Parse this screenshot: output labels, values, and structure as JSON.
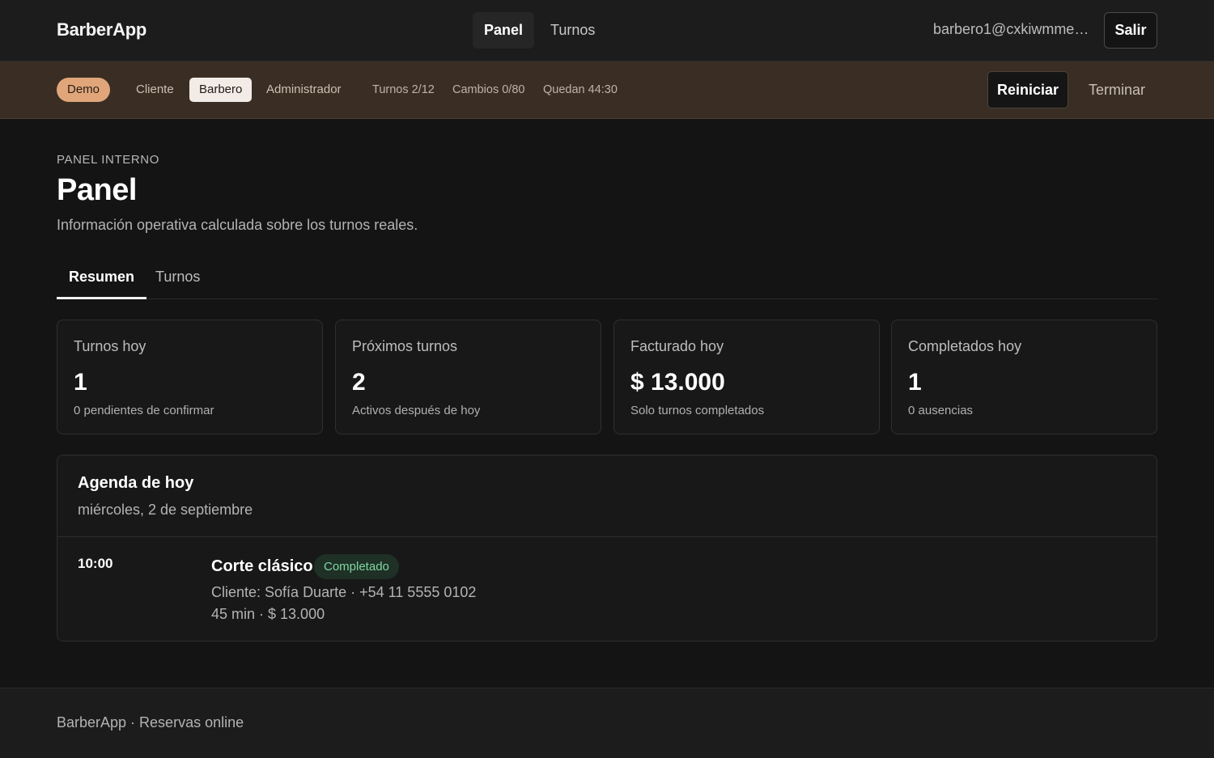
{
  "app": {
    "brand": "BarberApp"
  },
  "nav": {
    "tabs": [
      {
        "label": "Panel",
        "active": true
      },
      {
        "label": "Turnos",
        "active": false
      }
    ],
    "user_email": "barbero1@cxkiwmmee...",
    "logout_label": "Salir"
  },
  "demo": {
    "badge": "Demo",
    "roles": [
      {
        "label": "Cliente",
        "active": false
      },
      {
        "label": "Barbero",
        "active": true
      },
      {
        "label": "Administrador",
        "active": false
      }
    ],
    "stats": {
      "turnos": "Turnos 2/12",
      "cambios": "Cambios 0/80",
      "quedan": "Quedan 44:30"
    },
    "reset_label": "Reiniciar",
    "end_label": "Terminar"
  },
  "header": {
    "eyebrow": "PANEL INTERNO",
    "title": "Panel",
    "subtitle": "Información operativa calculada sobre los turnos reales."
  },
  "tabs": [
    {
      "label": "Resumen",
      "active": true
    },
    {
      "label": "Turnos",
      "active": false
    }
  ],
  "cards": [
    {
      "label": "Turnos hoy",
      "value": "1",
      "note": "0 pendientes de confirmar"
    },
    {
      "label": "Próximos turnos",
      "value": "2",
      "note": "Activos después de hoy"
    },
    {
      "label": "Facturado hoy",
      "value": "$ 13.000",
      "note": "Solo turnos completados"
    },
    {
      "label": "Completados hoy",
      "value": "1",
      "note": "0 ausencias"
    }
  ],
  "agenda": {
    "title": "Agenda de hoy",
    "date": "miércoles, 2 de septiembre",
    "appointments": [
      {
        "time": "10:00",
        "service": "Corte clásico",
        "status": "Completado",
        "client": "Cliente: Sofía Duarte · +54 11 5555 0102",
        "meta": "45 min · $ 13.000"
      }
    ]
  },
  "footer": {
    "text": "BarberApp · Reservas online"
  },
  "colors": {
    "background": "#141414",
    "demo_bar": "#3a2e24",
    "demo_badge": "#e0a67a",
    "status_green": "#7fd6a1"
  }
}
